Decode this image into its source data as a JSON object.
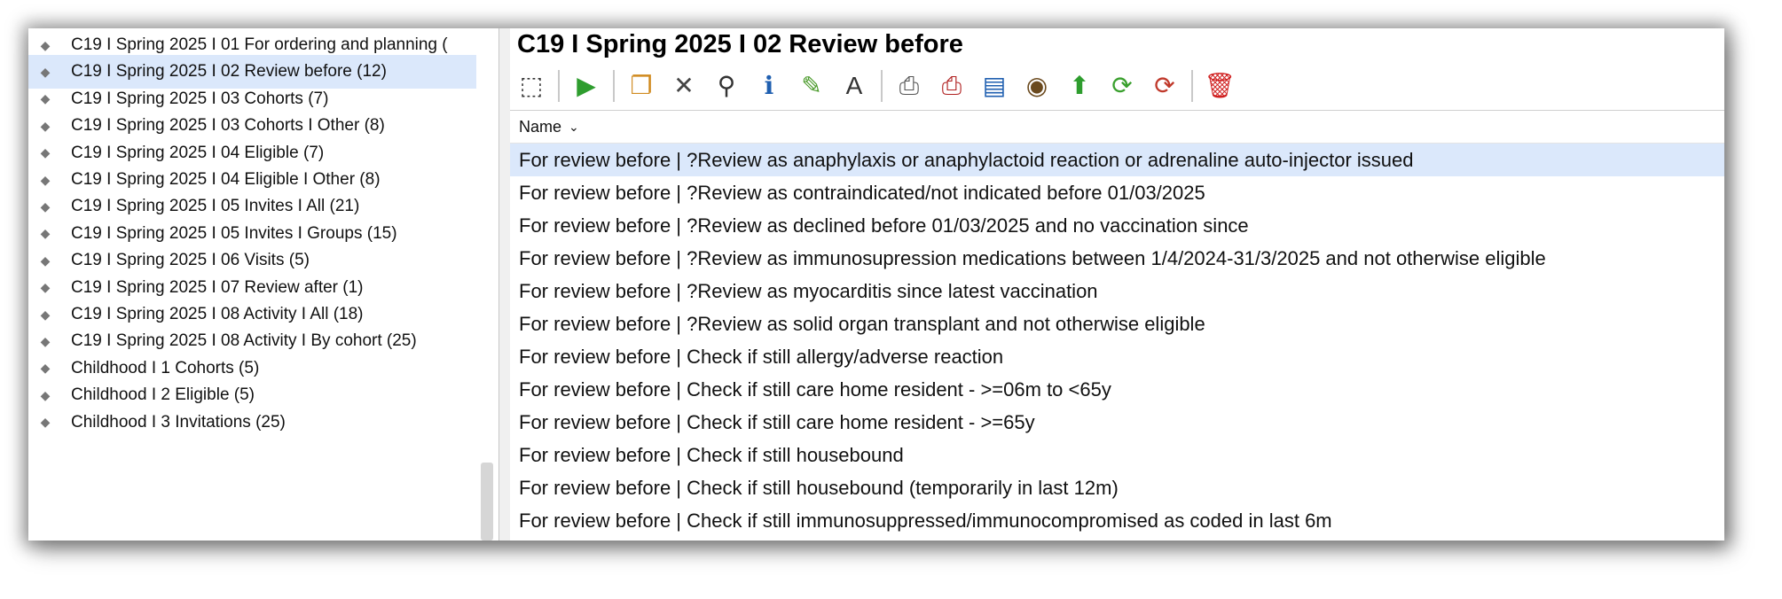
{
  "tree": {
    "items": [
      {
        "label": "C19 I Spring 2025 I 01 For ordering and planning (",
        "selected": false
      },
      {
        "label": "C19 I Spring 2025 I 02 Review before (12)",
        "selected": true
      },
      {
        "label": "C19 I Spring 2025 I 03 Cohorts (7)",
        "selected": false
      },
      {
        "label": "C19 I Spring 2025 I 03 Cohorts I Other (8)",
        "selected": false
      },
      {
        "label": "C19 I Spring 2025 I 04 Eligible (7)",
        "selected": false
      },
      {
        "label": "C19 I Spring 2025 I 04 Eligible I Other (8)",
        "selected": false
      },
      {
        "label": "C19 I Spring 2025 I 05 Invites I All (21)",
        "selected": false
      },
      {
        "label": "C19 I Spring 2025 I 05 Invites I Groups (15)",
        "selected": false
      },
      {
        "label": "C19 I Spring 2025 I 06 Visits (5)",
        "selected": false
      },
      {
        "label": "C19 I Spring 2025 I 07 Review after (1)",
        "selected": false
      },
      {
        "label": "C19 I Spring 2025 I 08 Activity I All (18)",
        "selected": false
      },
      {
        "label": "C19 I Spring 2025 I 08 Activity I By cohort (25)",
        "selected": false
      },
      {
        "label": "Childhood I 1 Cohorts (5)",
        "selected": false
      },
      {
        "label": "Childhood I 2 Eligible (5)",
        "selected": false
      },
      {
        "label": "Childhood I 3 Invitations (25)",
        "selected": false
      }
    ]
  },
  "main": {
    "title": "C19 I Spring 2025 I 02 Review before",
    "toolbar": [
      {
        "icon": "select-all-icon",
        "glyph": "⬚",
        "color": "#333333"
      },
      {
        "sep": true
      },
      {
        "icon": "run-icon",
        "glyph": "▶",
        "color": "#2e9d2e"
      },
      {
        "sep": true
      },
      {
        "icon": "copy-icon",
        "glyph": "❐",
        "color": "#d08a1e"
      },
      {
        "icon": "delete-x-icon",
        "glyph": "✕",
        "color": "#444444"
      },
      {
        "icon": "search-icon",
        "glyph": "⚲",
        "color": "#333333"
      },
      {
        "icon": "info-icon",
        "glyph": "ℹ",
        "color": "#1f5fb0"
      },
      {
        "icon": "edit-pen-icon",
        "glyph": "✎",
        "color": "#4a9a2a"
      },
      {
        "icon": "rename-icon",
        "glyph": "A",
        "color": "#333333"
      },
      {
        "sep": true
      },
      {
        "icon": "print-icon",
        "glyph": "⎙",
        "color": "#555555"
      },
      {
        "icon": "print-red-icon",
        "glyph": "⎙",
        "color": "#b02020"
      },
      {
        "icon": "report-icon",
        "glyph": "▤",
        "color": "#1f5fb0"
      },
      {
        "icon": "export-icon",
        "glyph": "◉",
        "color": "#6b4a1e"
      },
      {
        "icon": "move-up-icon",
        "glyph": "⬆",
        "color": "#2e9d2e"
      },
      {
        "icon": "refresh-icon",
        "glyph": "⟳",
        "color": "#3aa02e"
      },
      {
        "icon": "refresh-red-icon",
        "glyph": "⟳",
        "color": "#c0392b"
      },
      {
        "sep": true
      },
      {
        "icon": "trash-icon",
        "glyph": "🗑",
        "color": "#d02020"
      }
    ],
    "column_header": "Name",
    "rows": [
      {
        "text": "For review before | ?Review as anaphylaxis or anaphylactoid reaction or adrenaline auto-injector issued",
        "selected": true
      },
      {
        "text": "For review before | ?Review as contraindicated/not indicated before 01/03/2025",
        "selected": false
      },
      {
        "text": "For review before | ?Review as declined before 01/03/2025 and no vaccination since",
        "selected": false
      },
      {
        "text": "For review before | ?Review as immunosupression medications between 1/4/2024-31/3/2025 and not otherwise eligible",
        "selected": false
      },
      {
        "text": "For review before | ?Review as myocarditis since latest vaccination",
        "selected": false
      },
      {
        "text": "For review before | ?Review as solid organ transplant and not otherwise eligible",
        "selected": false
      },
      {
        "text": "For review before | Check if still allergy/adverse reaction",
        "selected": false
      },
      {
        "text": "For review before | Check if still care home resident - >=06m to <65y",
        "selected": false
      },
      {
        "text": "For review before | Check if still care home resident - >=65y",
        "selected": false
      },
      {
        "text": "For review before | Check if still housebound",
        "selected": false
      },
      {
        "text": "For review before | Check if still housebound (temporarily in last 12m)",
        "selected": false
      },
      {
        "text": "For review before | Check if still immunosuppressed/immunocompromised as coded in last 6m",
        "selected": false
      }
    ]
  }
}
